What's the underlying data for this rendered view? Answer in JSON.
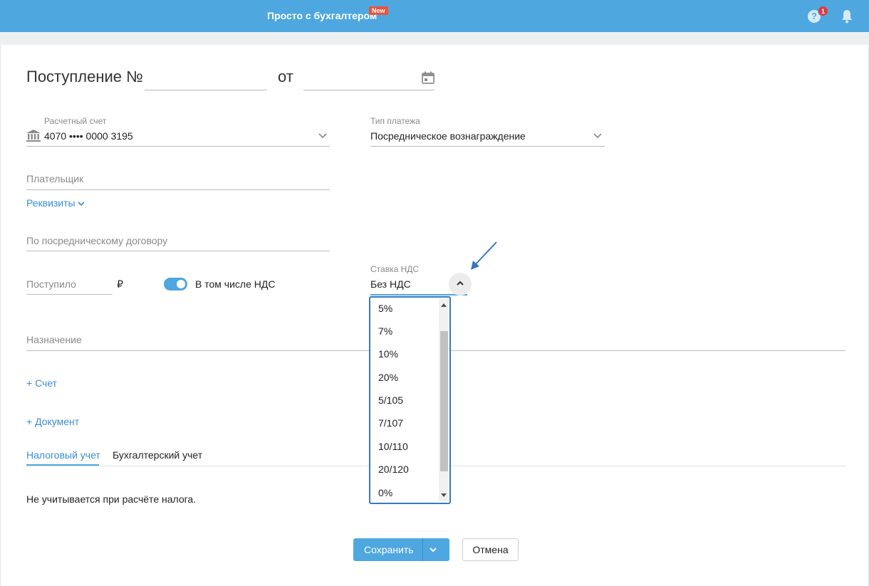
{
  "header": {
    "title": "Просто с бухгалтером",
    "new_badge": "New",
    "help_glyph": "?",
    "help_count": "1",
    "icons": [
      "help-icon",
      "bell-icon"
    ]
  },
  "document": {
    "title": "Поступление №",
    "number_value": "",
    "date_prefix": "от",
    "date_value": ""
  },
  "form": {
    "account_label": "Расчетный счет",
    "account_value": "4070 •••• 0000 3195",
    "payment_type_label": "Тип платежа",
    "payment_type_value": "Посредническое вознаграждение",
    "payer_placeholder": "Плательщик",
    "requisites_link": "Реквизиты",
    "contract_placeholder": "По посредническому договору",
    "received_placeholder": "Поступило",
    "currency": "₽",
    "vat_toggle_label": "В том числе НДС",
    "vat_toggle_on": true,
    "vat_rate_label": "Ставка НДС",
    "vat_rate_value": "Без НДС",
    "purpose_placeholder": "Назначение",
    "add_invoice_link": "+ Счет",
    "add_document_link": "+ Документ"
  },
  "vat_dropdown": {
    "options": [
      "5%",
      "7%",
      "10%",
      "20%",
      "5/105",
      "7/107",
      "10/110",
      "20/120",
      "0%"
    ]
  },
  "tabs": [
    {
      "label": "Налоговый учет",
      "active": true
    },
    {
      "label": "Бухгалтерский учет",
      "active": false
    }
  ],
  "tax_note": "Не учитывается при расчёте налога.",
  "actions": {
    "save_label": "Сохранить",
    "cancel_label": "Отмена"
  },
  "colors": {
    "accent": "#4ea7df",
    "badge": "#e9553f",
    "dropdown_border": "#3878c4"
  }
}
